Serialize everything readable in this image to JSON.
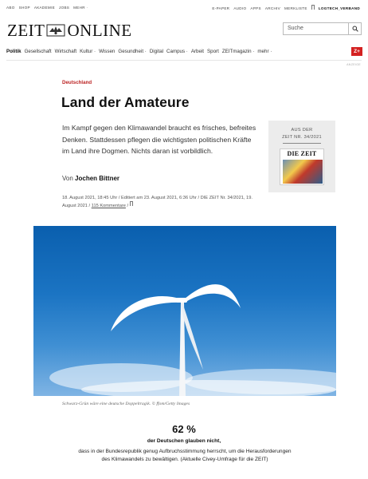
{
  "topbar": {
    "left_links": [
      "ABO",
      "SHOP",
      "AKADEMIE",
      "JOBS",
      "MEHR ·"
    ],
    "right_links": [
      "E-PAPER",
      "AUDIO",
      "APPS",
      "ARCHIV",
      "MERKLISTE"
    ],
    "user": "LOGTECH_VERBAND"
  },
  "logo": {
    "left": "ZEIT",
    "right": "ONLINE"
  },
  "search": {
    "placeholder": "Suche"
  },
  "nav": {
    "items": [
      {
        "label": "Politik",
        "active": true
      },
      {
        "label": "Gesellschaft"
      },
      {
        "label": "Wirtschaft"
      },
      {
        "label": "Kultur ·"
      },
      {
        "label": "Wissen"
      },
      {
        "label": "Gesundheit ·"
      },
      {
        "label": "Digital"
      },
      {
        "label": "Campus ·"
      },
      {
        "label": "Arbeit"
      },
      {
        "label": "Sport"
      },
      {
        "label": "ZEITmagazin ·"
      },
      {
        "label": "mehr ·"
      }
    ],
    "zplus": "Z+",
    "anzeige": "ANZEIGE"
  },
  "article": {
    "kicker": "Deutschland",
    "title": "Land der Amateure",
    "summary": "Im Kampf gegen den Klimawandel braucht es frisches, befreites Denken. Stattdessen pflegen die wichtigsten politischen Kräfte im Land ihre Dogmen. Nichts daran ist vorbildlich.",
    "author_prefix": "Von",
    "author": "Jochen Bittner",
    "published": "18. August 2021, 18:45 Uhr",
    "edited": "Editiert am 23. August 2021, 6:36 Uhr",
    "source_a": "DIE ZEIT",
    "source_b": "Nr. 34/2021, 19. August 2021",
    "comments": "115 Kommentare"
  },
  "issue_box": {
    "line1": "AUS DER",
    "line2": "ZEIT NR. 34/2021",
    "cover_masthead": "DIE ZEIT"
  },
  "image": {
    "caption": "Schwarz-Grün wäre eine deutsche Doppeltragik. © ffom/Getty Images"
  },
  "stat": {
    "value": "62 %",
    "label": "der Deutschen glauben nicht,",
    "text": "dass in der Bundesrepublik genug Aufbruchsstimmung herrscht, um die Herausforderungen des Klimawandels zu bewältigen. (Aktuelle Civey-Umfrage für die ZEIT)"
  },
  "colors": {
    "kicker": "#bb2222",
    "zplus": "#d42121",
    "sky": "#1b74c3"
  }
}
